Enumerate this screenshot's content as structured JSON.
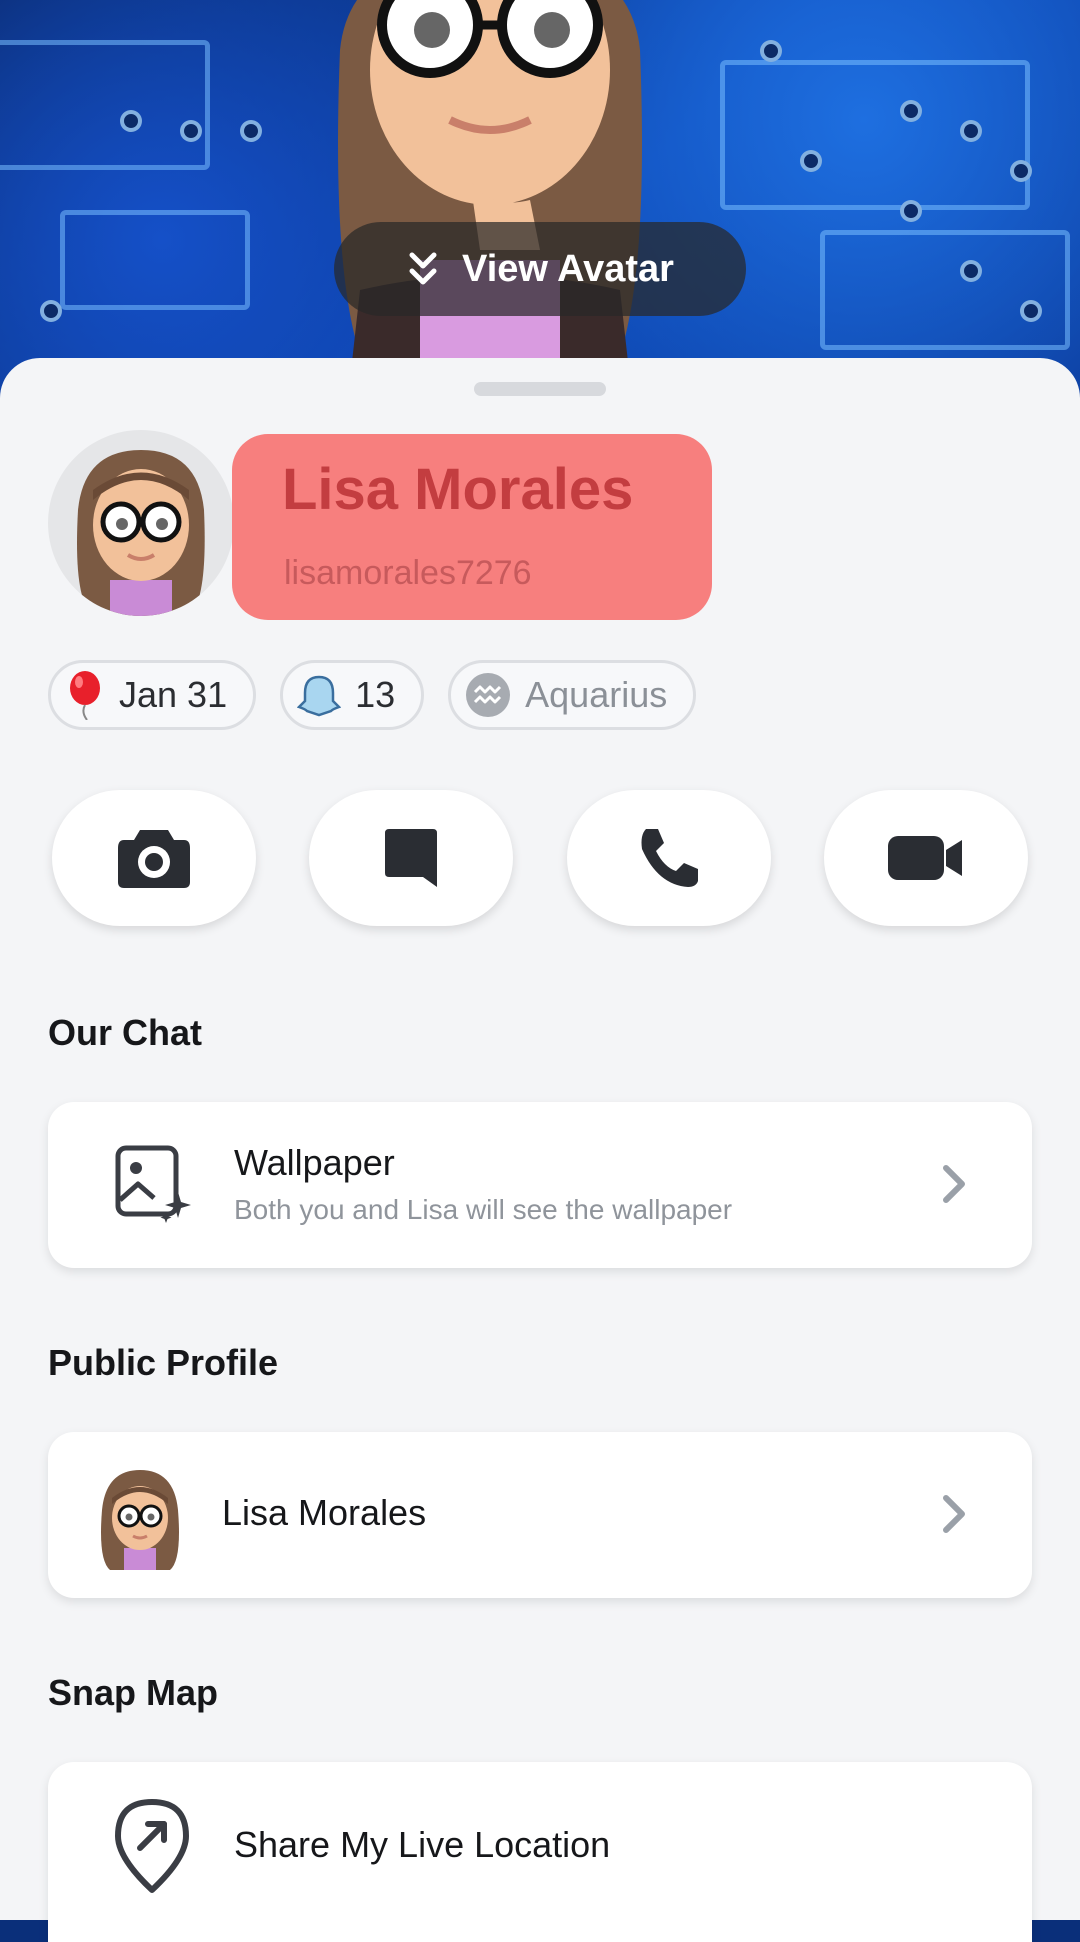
{
  "header": {
    "view_avatar_label": "View Avatar"
  },
  "profile": {
    "display_name": "Lisa Morales",
    "username": "lisamorales7276"
  },
  "chips": [
    {
      "icon": "balloon-icon",
      "label": "Jan 31"
    },
    {
      "icon": "snapscore-ghost-icon",
      "label": "13"
    },
    {
      "icon": "aquarius-icon",
      "label": "Aquarius"
    }
  ],
  "actions": [
    {
      "icon": "camera-icon"
    },
    {
      "icon": "chat-icon"
    },
    {
      "icon": "phone-icon"
    },
    {
      "icon": "video-call-icon"
    }
  ],
  "sections": {
    "our_chat": {
      "title": "Our Chat",
      "wallpaper_title": "Wallpaper",
      "wallpaper_subtitle": "Both you and Lisa will see the wallpaper"
    },
    "public_profile": {
      "title": "Public Profile",
      "item_label": "Lisa Morales"
    },
    "snap_map": {
      "title": "Snap Map",
      "item_label": "Share My Live Location"
    }
  },
  "colors": {
    "name_highlight": "#f77f7e",
    "name_text": "#c33d40",
    "sheet_bg": "#f4f5f7",
    "icon_dark": "#2a2d33"
  }
}
